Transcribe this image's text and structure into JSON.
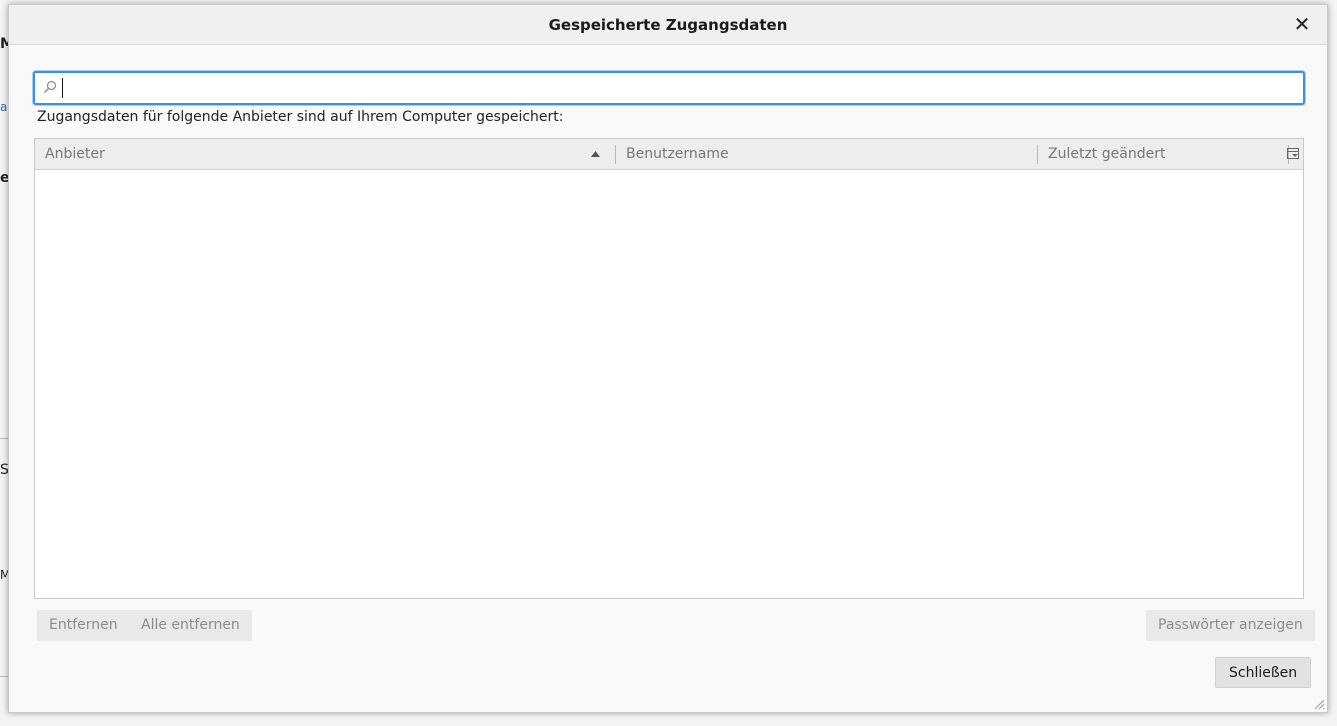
{
  "dialog": {
    "title": "Gespeicherte Zugangsdaten",
    "close_glyph": "✕"
  },
  "search": {
    "value": "",
    "placeholder": ""
  },
  "intro_text": "Zugangsdaten für folgende Anbieter sind auf Ihrem Computer gespeichert:",
  "table": {
    "columns": [
      "Anbieter",
      "Benutzername",
      "Zuletzt geändert"
    ],
    "sort_column": "Anbieter",
    "sort_direction": "ascending",
    "rows": []
  },
  "buttons": {
    "remove": "Entfernen",
    "remove_all": "Alle entfernen",
    "show_passwords": "Passwörter anzeigen",
    "close": "Schließen"
  },
  "colors": {
    "focus_ring": "#3d8ee6",
    "disabled_text": "#8c8c8c"
  }
}
